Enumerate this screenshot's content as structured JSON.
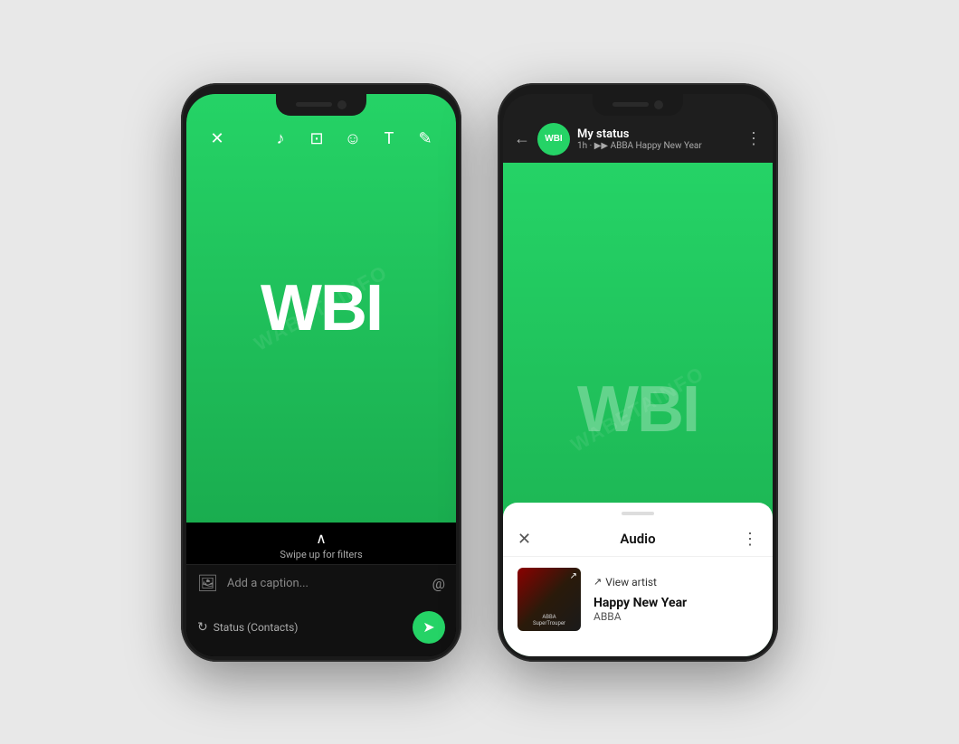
{
  "page": {
    "background": "#e8e8e8"
  },
  "phone1": {
    "toolbar": {
      "close_icon": "✕",
      "music_icon": "♪",
      "crop_icon": "⊡",
      "emoji_icon": "☺",
      "text_icon": "T",
      "pen_icon": "✎"
    },
    "content": {
      "logo": "WBI",
      "swipe_text": "Swipe up for filters"
    },
    "caption": {
      "placeholder": "Add a caption...",
      "mention_icon": "@"
    },
    "footer": {
      "status_label": "Status (Contacts)",
      "send_icon": "➤"
    }
  },
  "phone2": {
    "header": {
      "back_icon": "←",
      "avatar_label": "WBI",
      "status_name": "My status",
      "status_meta": "1h · ▶▶ ABBA Happy New Year",
      "more_icon": "⋮"
    },
    "content": {
      "logo": "WBI"
    },
    "sheet": {
      "close_icon": "✕",
      "title": "Audio",
      "more_icon": "⋮",
      "view_artist_icon": "⬡",
      "view_artist_text": "View artist",
      "album_label1": "ABBA",
      "album_label2": "SuperTrouper",
      "track_title": "Happy New Year",
      "track_artist": "ABBA"
    }
  }
}
